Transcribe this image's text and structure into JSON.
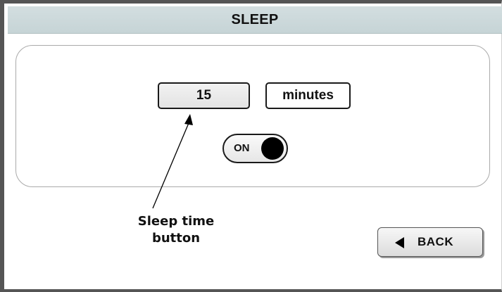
{
  "header": {
    "title": "SLEEP"
  },
  "sleep": {
    "time_value": "15",
    "unit_label": "minutes",
    "toggle_label": "ON",
    "toggle_state": "on"
  },
  "annotation": {
    "line1": "Sleep time",
    "line2": "button"
  },
  "footer": {
    "back_label": "BACK",
    "back_icon": "left-triangle-icon"
  },
  "colors": {
    "title_bar": "#c9d6d8",
    "frame": "#555555",
    "knob": "#000000"
  }
}
